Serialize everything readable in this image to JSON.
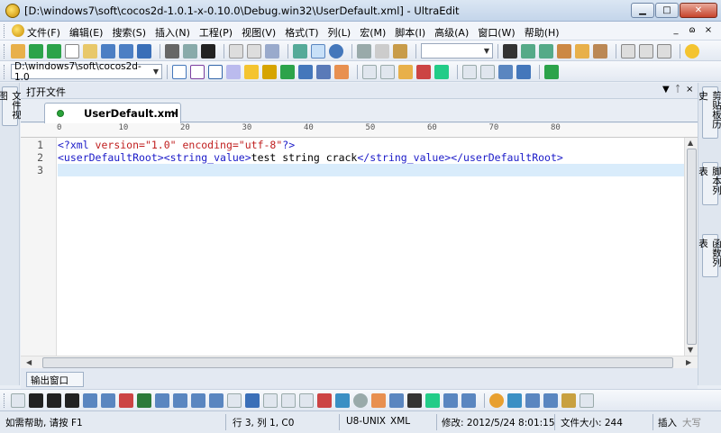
{
  "window": {
    "title": "[D:\\windows7\\soft\\cocos2d-1.0.1-x-0.10.0\\Debug.win32\\UserDefault.xml] - UltraEdit",
    "minimize_icon": "minimize-icon",
    "maximize_icon": "maximize-icon",
    "close_label": "✕"
  },
  "menu": {
    "items": [
      "文件(F)",
      "编辑(E)",
      "搜索(S)",
      "插入(N)",
      "工程(P)",
      "视图(V)",
      "格式(T)",
      "列(L)",
      "宏(M)",
      "脚本(I)",
      "高级(A)",
      "窗口(W)",
      "帮助(H)"
    ],
    "mdi_controls": [
      "_",
      "ɷ",
      "×"
    ]
  },
  "toolbar2": {
    "path_combo": "D:\\windows7\\soft\\cocos2d-1.0"
  },
  "left_panels": [
    "文件视图"
  ],
  "right_panels": [
    "剪贴板历史",
    "脚本列表",
    "函数列表"
  ],
  "panel": {
    "title": "打开文件"
  },
  "tabs": [
    {
      "label": "UserDefault.xml",
      "close": "×"
    }
  ],
  "ruler": {
    "ticks": [
      "0",
      "10",
      "20",
      "30",
      "40",
      "50",
      "60",
      "70",
      "80"
    ]
  },
  "editor": {
    "line_numbers": [
      "1",
      "2",
      "3"
    ],
    "lines": [
      {
        "tokens": [
          {
            "t": "<?xml ",
            "c": "xml-tag"
          },
          {
            "t": "version=",
            "c": "xml-attr"
          },
          {
            "t": "\"1.0\" ",
            "c": "xml-val"
          },
          {
            "t": "encoding=",
            "c": "xml-attr"
          },
          {
            "t": "\"utf-8\"",
            "c": "xml-val"
          },
          {
            "t": "?>",
            "c": "xml-tag"
          }
        ]
      },
      {
        "tokens": [
          {
            "t": "<userDefaultRoot>",
            "c": "xml-tag"
          },
          {
            "t": "<string_value>",
            "c": "xml-tag"
          },
          {
            "t": "test string crack",
            "c": "xml-text"
          },
          {
            "t": "</string_value>",
            "c": "xml-tag"
          },
          {
            "t": "</userDefaultRoot>",
            "c": "xml-tag"
          }
        ]
      },
      {
        "tokens": []
      }
    ],
    "current_line": 3
  },
  "output": {
    "tab_label": "输出窗口"
  },
  "status": {
    "help": "如需帮助, 请按 F1",
    "position": "行 3, 列 1, C0",
    "encoding": "U8-UNIX",
    "syntax": "XML",
    "modified": "修改: 2012/5/24 8:01:15",
    "filesize": "文件大小: 244",
    "insert": "插入",
    "caps": "大写"
  }
}
